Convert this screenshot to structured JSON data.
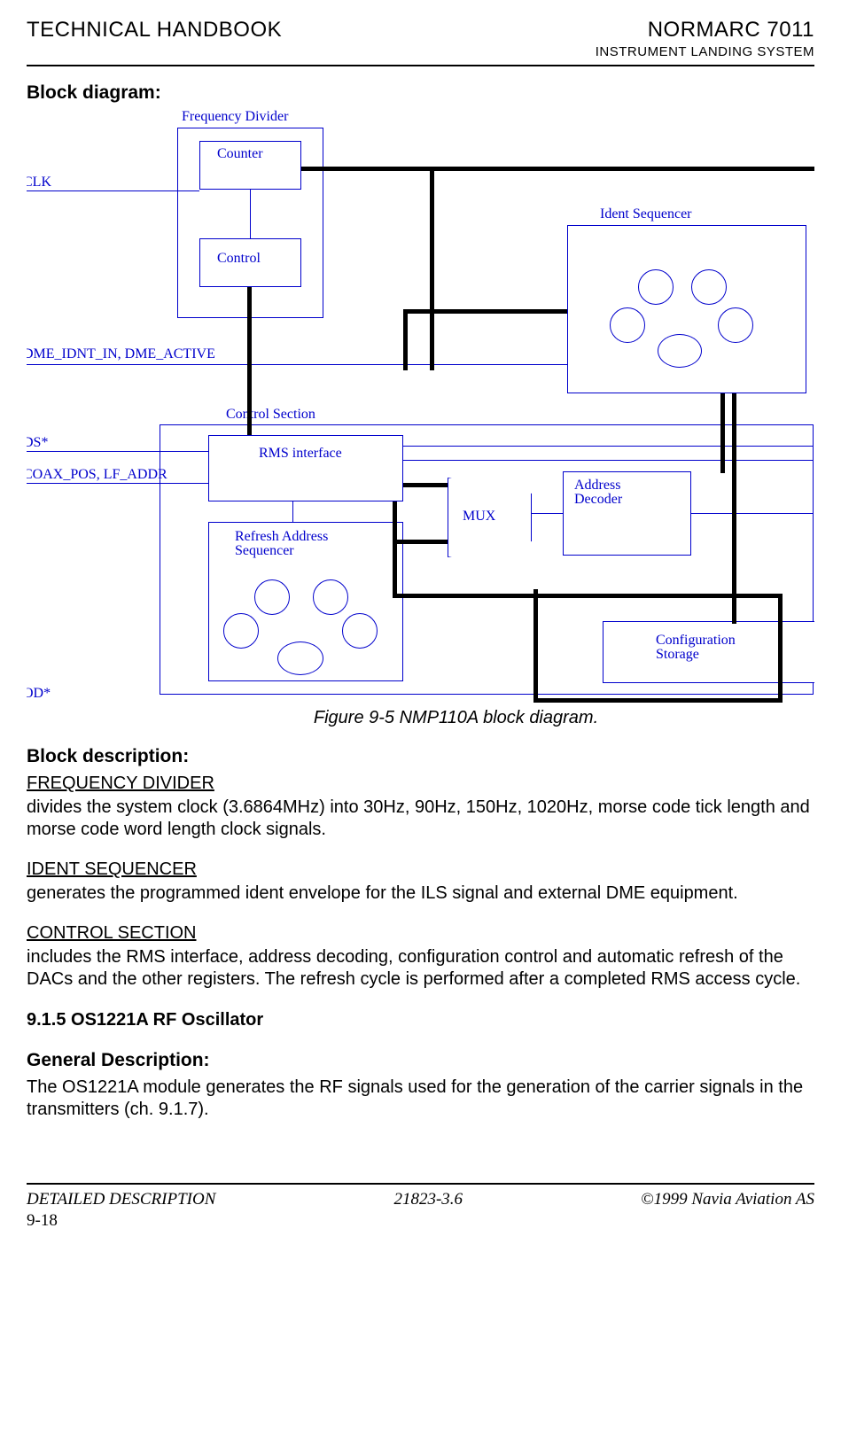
{
  "header": {
    "left": "TECHNICAL HANDBOOK",
    "right_title": "NORMARC 7011",
    "right_subtitle": "INSTRUMENT LANDING SYSTEM"
  },
  "block_diagram_title": "Block diagram:",
  "diagram": {
    "freq_divider": "Frequency Divider",
    "counter": "Counter",
    "control": "Control",
    "clk": "CLK",
    "ident_sequencer": "Ident Sequencer",
    "dme_line": "DME_IDNT_IN, DME_ACTIVE",
    "control_section": "Control Section",
    "s_star": "DS*",
    "coax_line": "COAX_POS, LF_ADDR",
    "rms_interface": "RMS interface",
    "mux": "MUX",
    "addr_decoder_l1": "Address",
    "addr_decoder_l2": "Decoder",
    "refresh_l1": "Refresh Address",
    "refresh_l2": "Sequencer",
    "config_l1": "Configuration",
    "config_l2": "Storage",
    "od_star": "OD*"
  },
  "figure_caption": "Figure 9-5 NMP110A block diagram.",
  "block_description_title": "Block description:",
  "freq_head": "FREQUENCY DIVIDER",
  "freq_body": "divides the system clock (3.6864MHz) into 30Hz, 90Hz, 150Hz, 1020Hz, morse code tick length and morse code word length clock signals.",
  "ident_head": "IDENT SEQUENCER",
  "ident_body": "generates the programmed ident envelope for the ILS signal and external DME equipment.",
  "ctrl_head": "CONTROL SECTION",
  "ctrl_body": "includes the RMS interface, address decoding, configuration control and automatic refresh of the DACs and the other registers. The refresh cycle is performed after a completed RMS access cycle.",
  "numbered_head": "9.1.5      OS1221A RF Oscillator",
  "gen_desc_title": "General Description:",
  "gen_desc_body": "The OS1221A module generates the RF signals used for the generation of the carrier signals in the transmitters (ch. 9.1.7).",
  "footer": {
    "left": "DETAILED DESCRIPTION",
    "center": "21823-3.6",
    "right": "©1999 Navia Aviation AS",
    "page": "9-18"
  }
}
